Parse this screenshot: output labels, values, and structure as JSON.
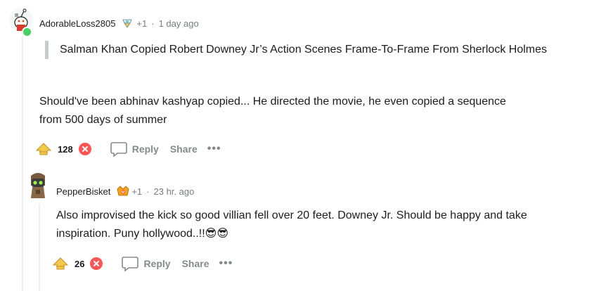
{
  "comments": [
    {
      "username": "AdorableLoss2805",
      "award_count": "+1",
      "separator": "·",
      "time": "1 day ago",
      "quote": "Salman Khan Copied Robert Downey Jr’s Action Scenes Frame-To-Frame From Sherlock Holmes",
      "body": "Should've been abhinav kashyap copied... He directed the movie, he even copied a sequence from 500 days of summer",
      "score": "128",
      "reply_label": "Reply",
      "share_label": "Share",
      "more_label": "•••"
    },
    {
      "username": "PepperBisket",
      "award_count": "+1",
      "separator": "·",
      "time": "23 hr. ago",
      "body": "Also improvised the kick so good villian fell over 20 feet. Downey Jr. Should be happy and take inspiration. Puny hollywood..!!",
      "emoji": "😎😎",
      "score": "26",
      "reply_label": "Reply",
      "share_label": "Share",
      "more_label": "•••"
    }
  ],
  "colors": {
    "upvote_gold": "#e8b94a",
    "downvote_red": "#ff5555",
    "online_green": "#46d160",
    "thread_line": "#edeff1",
    "meta_gray": "#787c7e"
  }
}
